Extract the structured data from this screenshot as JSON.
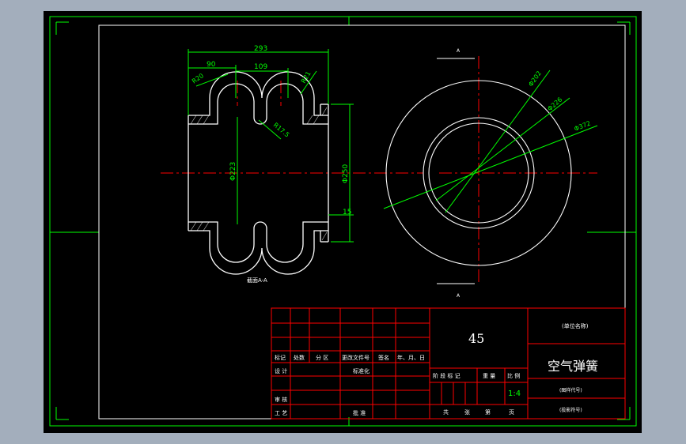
{
  "colors": {
    "background": "#a3aebc",
    "canvas": "#000000",
    "outline": "#ffffff",
    "dimension": "#00ff00",
    "centerline": "#ff0000",
    "title_block": "#ff0000"
  },
  "drawing": {
    "dims": {
      "overall_width": "293",
      "left_offset": "90",
      "pitch": "109",
      "radius_left": "R20",
      "radius_right": "R21",
      "radius_inner": "R17.5",
      "inner_dia": "Φ223",
      "outer_dia": "Φ250",
      "flange": "15",
      "circle_dia_1": "Φ202",
      "circle_dia_2": "Φ226",
      "circle_dia_3": "Φ372"
    },
    "section_label": "截面A-A",
    "view_mark_top": "A",
    "view_mark_bottom": "A"
  },
  "title_block": {
    "material": "45",
    "part_name": "空气弹簧",
    "unit_placeholder": "(单位名称)",
    "drawing_no_placeholder": "(图样代号)",
    "project_placeholder": "(投影符号)",
    "scale": "1:4",
    "rev_headers": [
      "标记",
      "处数",
      "分 区",
      "更改文件号",
      "签名",
      "年、月、日"
    ],
    "row_design": "设 计",
    "row_standard": "标准化",
    "row_review": "审 核",
    "row_process": "工 艺",
    "row_approve": "批 准",
    "stage_headers": [
      "阶 段 标 记",
      "重 量",
      "比 例"
    ],
    "sheet_footer": [
      "共",
      "张",
      "第",
      "页"
    ]
  }
}
